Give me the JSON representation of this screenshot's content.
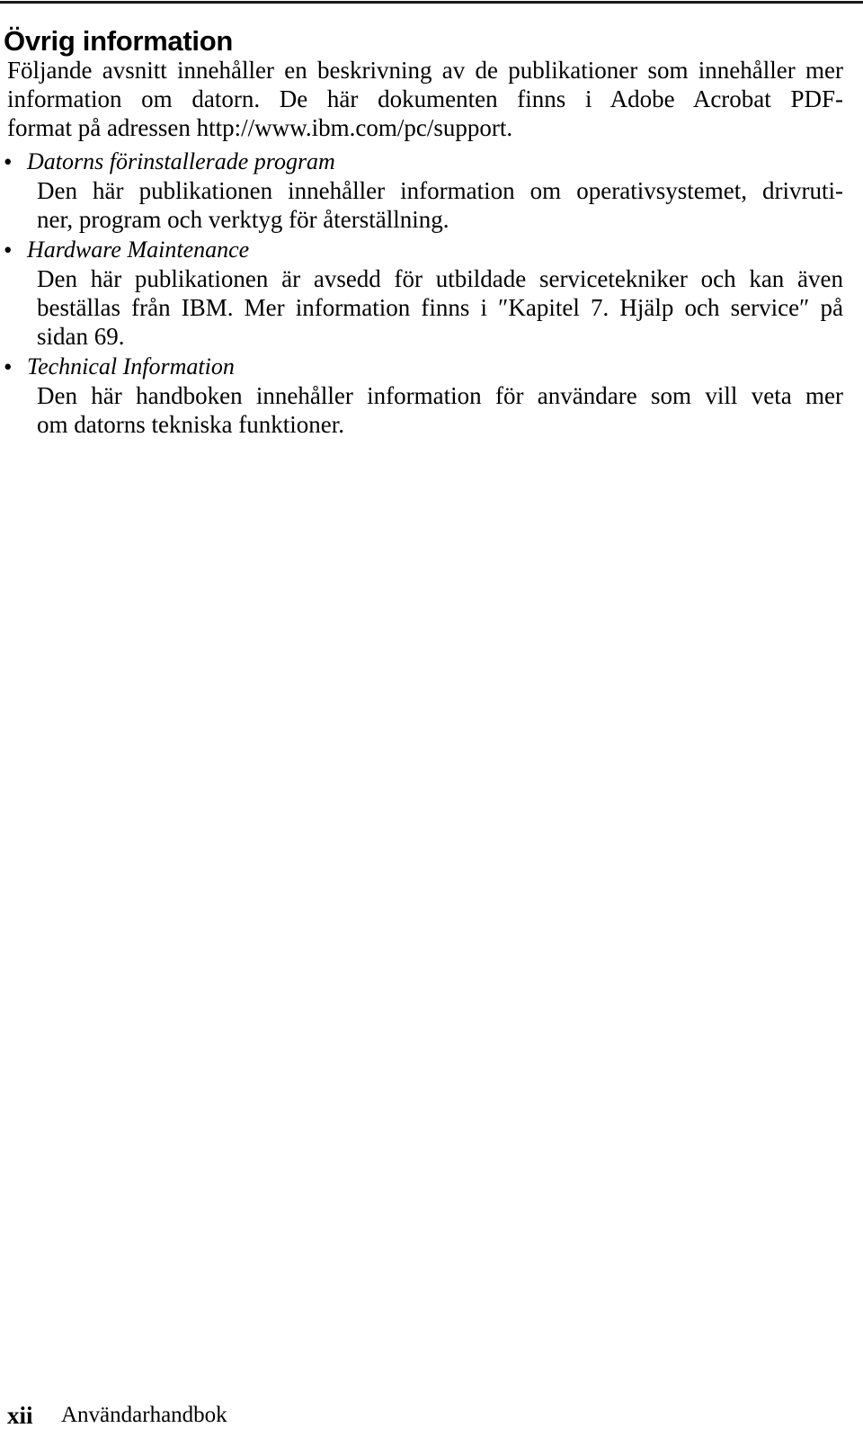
{
  "page": {
    "title": "Övrig information",
    "intro_lines": [
      "Följande avsnitt innehåller en beskrivning av de publikationer som innehåller",
      "mer information om datorn. De här dokumenten finns i Adobe Acrobat PDF-",
      "format på adressen http://www.ibm.com/pc/support."
    ],
    "bullet_glyph": "•"
  },
  "items": [
    {
      "title": "Datorns förinstallerade program",
      "desc_lines": [
        "Den här publikationen innehåller information om operativsystemet, drivruti-",
        "ner, program och verktyg för återställning."
      ]
    },
    {
      "title": "Hardware Maintenance",
      "desc_lines": [
        "Den här publikationen är avsedd för utbildade servicetekniker och kan även",
        "beställas från IBM. Mer information finns i ″Kapitel 7. Hjälp och service″ på",
        "sidan 69."
      ]
    },
    {
      "title": "Technical Information",
      "desc_lines": [
        "Den här handboken innehåller information för användare som vill veta mer",
        "om datorns tekniska funktioner."
      ]
    }
  ],
  "footer": {
    "page_number": "xii",
    "book_title": "Användarhandbok"
  }
}
